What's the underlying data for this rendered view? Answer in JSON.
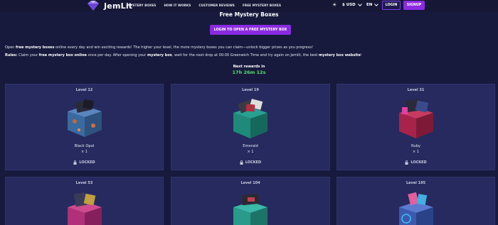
{
  "header": {
    "logo_text": "JemLit",
    "nav": [
      "MYSTERY BOXES",
      "HOW IT WORKS",
      "CUSTOMER REVIEWS",
      "FREE MYSTERY BOXES"
    ],
    "currency": "$ USD",
    "language": "EN",
    "login_label": "LOGIN",
    "signup_label": "SIGNUP"
  },
  "hero": {
    "title": "Free Mystery Boxes",
    "cta_label": "LOGIN TO OPEN A FREE MYSTERY BOX",
    "para1": {
      "pre": "Open ",
      "bold1": "free mystery boxes",
      "post": " online every day and win exciting rewards! The higher your level, the more mystery boxes you can claim—unlock bigger prizes as you progress!"
    },
    "para2": {
      "bold_rules": "Rules:",
      "t1": " Claim your ",
      "bold2": "free mystery box online",
      "t2": " once per day. After opening your ",
      "bold3": "mystery box",
      "t3": ", wait for the next drop at 00:00 Greenwich Time and try again on Jemlit, the best ",
      "bold4": "mystery box website",
      "t4": "!"
    },
    "next_rewards_label": "Next rewards in",
    "timer": "17h 26m 12s"
  },
  "cards": [
    {
      "level": "Level 12",
      "name": "Black Opal",
      "qty": "× 1",
      "status": "LOCKED",
      "color": "#3b6aa0"
    },
    {
      "level": "Level 19",
      "name": "Emerald",
      "qty": "× 1",
      "status": "LOCKED",
      "color": "#1f8a7a"
    },
    {
      "level": "Level 31",
      "name": "Ruby",
      "qty": "× 1",
      "status": "LOCKED",
      "color": "#a8234a"
    },
    {
      "level": "Level 53",
      "color": "#b0307a"
    },
    {
      "level": "Level 104",
      "color": "#2a9a8a"
    },
    {
      "level": "Level 195",
      "color": "#3a5ab0"
    }
  ],
  "colors": {
    "background": "#171a3c",
    "card": "#262a5e",
    "accent": "#8a2be2",
    "timer": "#4fe36b"
  }
}
